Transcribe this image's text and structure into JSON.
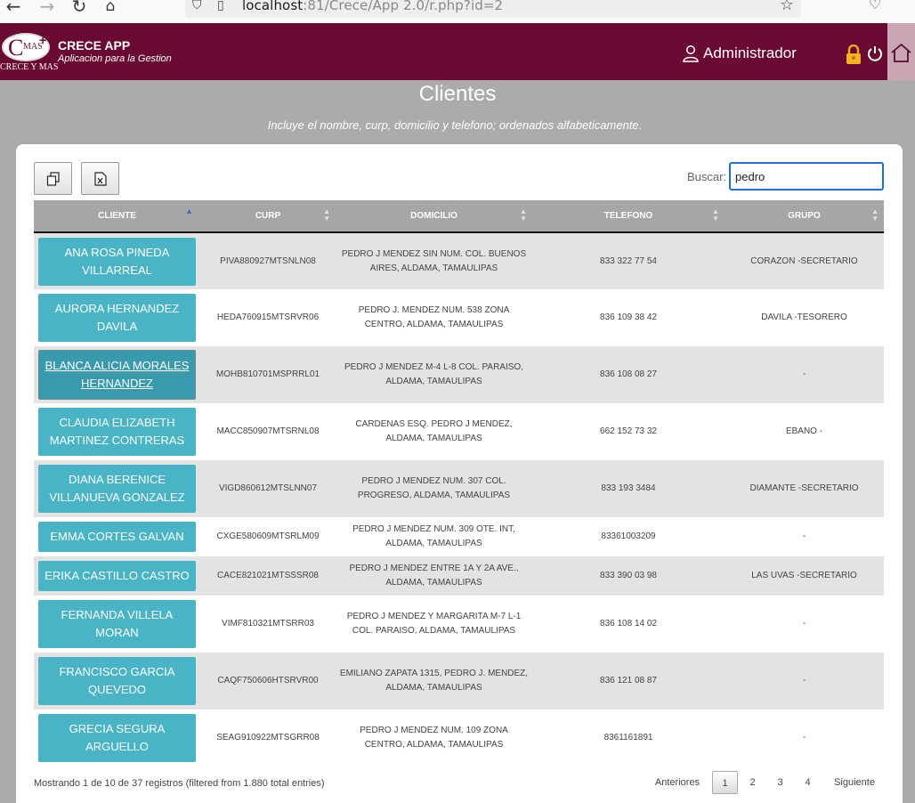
{
  "browser": {
    "url_host": "localhost",
    "url_rest": ":81/Crece/App 2.0/r.php?id=2"
  },
  "header": {
    "logo_text": "CRECE Y MAS",
    "logo_mark": "MAS",
    "app_name": "CRECE APP",
    "tagline": "Aplicacion para la Gestion",
    "user": "Administrador"
  },
  "page": {
    "title": "Clientes",
    "subtitle": "Incluye el nombre, curp, domicilio y telefono; ordenados alfabeticamente."
  },
  "toolbar": {
    "copy_icon": "copy-icon",
    "excel_icon": "excel-icon"
  },
  "search": {
    "label": "Buscar:",
    "value": "pedro"
  },
  "table": {
    "columns": [
      "CLIENTE",
      "CURP",
      "DOMICILIO",
      "TELEFONO",
      "GRUPO"
    ],
    "rows": [
      {
        "cliente": "ANA ROSA PINEDA VILLARREAL",
        "curp": "PIVA880927MTSNLN08",
        "domicilio": "PEDRO J MENDEZ SIN NUM. COL. BUENOS AIRES, ALDAMA, TAMAULIPAS",
        "telefono": "833 322 77 54",
        "grupo": "CORAZON -SECRETARIO"
      },
      {
        "cliente": "AURORA HERNANDEZ DAVILA",
        "curp": "HEDA760915MTSRVR06",
        "domicilio": "PEDRO J. MENDEZ NUM. 538 ZONA CENTRO, ALDAMA, TAMAULIPAS",
        "telefono": "836 109 38 42",
        "grupo": "DAVILA -TESORERO"
      },
      {
        "cliente": "BLANCA ALICIA MORALES HERNANDEZ",
        "curp": "MOHB810701MSPRRL01",
        "domicilio": "PEDRO J MENDEZ M-4 L-8 COL. PARAISO, ALDAMA, TAMAULIPAS",
        "telefono": "836 108 08 27",
        "grupo": "-"
      },
      {
        "cliente": "CLAUDIA ELIZABETH MARTINEZ CONTRERAS",
        "curp": "MACC850907MTSRNL08",
        "domicilio": "CARDENAS ESQ. PEDRO J MENDEZ, ALDAMA, TAMAULIPAS",
        "telefono": "662 152 73 32",
        "grupo": "EBANO -"
      },
      {
        "cliente": "DIANA BERENICE VILLANUEVA GONZALEZ",
        "curp": "VIGD860612MTSLNN07",
        "domicilio": "PEDRO J MENDEZ NUM. 307 COL. PROGRESO, ALDAMA, TAMAULIPAS",
        "telefono": "833 193 3484",
        "grupo": "DIAMANTE -SECRETARIO"
      },
      {
        "cliente": "EMMA CORTES GALVAN",
        "curp": "CXGE580609MTSRLM09",
        "domicilio": "PEDRO J MENDEZ NUM. 309 OTE. INT, ALDAMA, TAMAULIPAS",
        "telefono": "83361003209",
        "grupo": "-"
      },
      {
        "cliente": "ERIKA CASTILLO CASTRO",
        "curp": "CACE821021MTSSSR08",
        "domicilio": "PEDRO J MENDEZ ENTRE 1A Y 2A AVE., ALDAMA, TAMAULIPAS",
        "telefono": "833 390 03 98",
        "grupo": "LAS UVAS -SECRETARIO"
      },
      {
        "cliente": "FERNANDA VILLELA MORAN",
        "curp": "VIMF810321MTSRR03",
        "domicilio": "PEDRO J MENDEZ Y MARGARITA M-7 L-1 COL. PARAISO, ALDAMA, TAMAULIPAS",
        "telefono": "836 108 14 02",
        "grupo": "-"
      },
      {
        "cliente": "FRANCISCO GARCIA QUEVEDO",
        "curp": "CAQF750606HTSRVR00",
        "domicilio": "EMILIANO ZAPATA 1315, PEDRO J. MENDEZ, ALDAMA, TAMAULIPAS",
        "telefono": "836 121 08 87",
        "grupo": "-"
      },
      {
        "cliente": "GRECIA SEGURA ARGUELLO",
        "curp": "SEAG910922MTSGRR08",
        "domicilio": "PEDRO J MENDEZ NUM. 109 ZONA CENTRO, ALDAMA, TAMAULIPAS",
        "telefono": "8361161891",
        "grupo": "-"
      }
    ],
    "active_row": 2
  },
  "footer": {
    "info": "Mostrando 1 de 10 de 37 registros (filtered from 1.880 total entries)",
    "prev": "Anteriores",
    "pages": [
      "1",
      "2",
      "3",
      "4"
    ],
    "current_page": "1",
    "next": "Siguiente"
  },
  "colors": {
    "header_bg": "#6a0a33",
    "page_bg": "#ababab",
    "client_button": "#48b4c6",
    "table_header": "#a6a6a6"
  }
}
